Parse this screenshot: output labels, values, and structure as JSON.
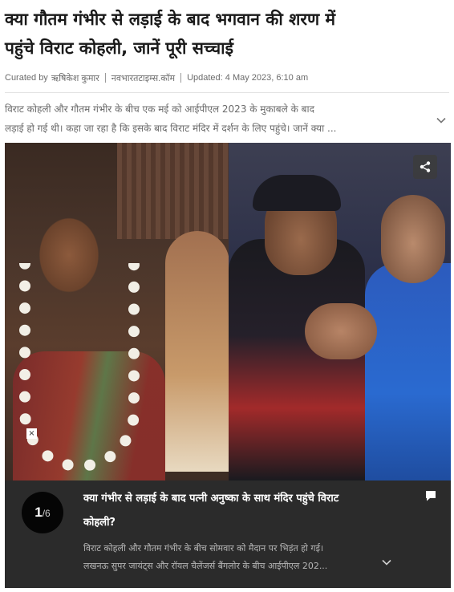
{
  "article": {
    "headline_line1": "क्या गौतम गंभीर से लड़ाई के बाद भगवान की शरण में",
    "headline_line2": "पहुंचे विराट कोहली, जानें पूरी सच्चाई",
    "curated_label": "Curated by",
    "author": "ऋषिकेश कुमार",
    "publication": "नवभारतटाइम्स.कॉम",
    "updated": "Updated: 4 May 2023, 6:10 am",
    "summary_line1": "विराट कोहली और गौतम गंभीर के बीच एक मई को आईपीएल 2023 के मुकाबले के बाद",
    "summary_line2": "लड़ाई हो गई थी। कहा जा रहा है कि इसके बाद विराट मंदिर में दर्शन के लिए पहुंचे। जानें क्या ..."
  },
  "gallery": {
    "ad_close": "×",
    "current": "1",
    "total": "/6",
    "caption_title_line1": "क्या गंभीर से लड़ाई के बाद पत्नी अनुष्का के साथ मंदिर पहुंचे विराट",
    "caption_title_line2": "कोहली?",
    "caption_text_line1": "विराट कोहली और गौतम गंभीर के बीच सोमवार को मैदान पर भिड़ंत हो गई।",
    "caption_text_line2": "लखनऊ सुपर जायंट्स और रॉयल चैलेंजर्स बैंगलोर के बीच आईपीएल 202..."
  },
  "icons": {
    "summary_toggle": "chevron-down-icon",
    "share": "share-icon",
    "comment": "comment-icon",
    "caption_toggle": "chevron-down-icon"
  },
  "colors": {
    "caption_panel": "#2b2b2b",
    "counter_bg": "#050505"
  }
}
